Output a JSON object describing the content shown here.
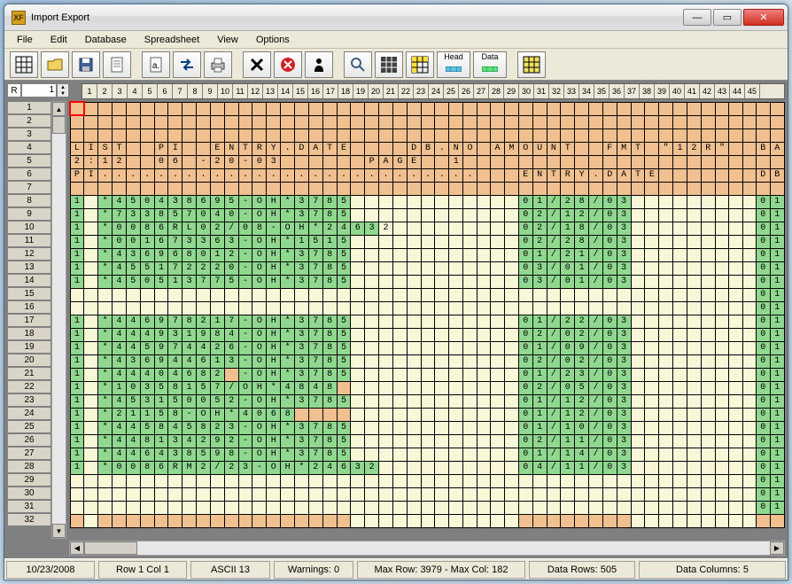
{
  "window": {
    "title": "Import Export"
  },
  "menu": [
    "File",
    "Edit",
    "Database",
    "Spreadsheet",
    "View",
    "Options"
  ],
  "toolbar": {
    "head_label": "Head",
    "data_label": "Data"
  },
  "ruler": {
    "r_label": "R",
    "r_value": "1"
  },
  "column_headers_start": 1,
  "column_headers_end": 45,
  "row_headers_start": 1,
  "row_headers_end": 32,
  "cursor": {
    "row": 1,
    "col": 1
  },
  "grid_rows": [
    {
      "r": 1,
      "cells": {}
    },
    {
      "r": 2,
      "cells": {}
    },
    {
      "r": 3,
      "cells": {}
    },
    {
      "r": 4,
      "cells": {
        "1": "L",
        "2": "I",
        "3": "S",
        "4": "T",
        "7": "P",
        "8": "I",
        "11": "E",
        "12": "N",
        "13": "T",
        "14": "R",
        "15": "Y",
        "16": ".",
        "17": "D",
        "18": "A",
        "19": "T",
        "20": "E",
        "25": "D",
        "26": "B",
        "27": ".",
        "28": "N",
        "29": "O",
        "31": "A",
        "32": "M",
        "33": "O",
        "34": "U",
        "35": "N",
        "36": "T",
        "39": "F",
        "40": "M",
        "41": "T",
        "43": "\"",
        "44": "1",
        "45": "2",
        "46": "R",
        "47": "\"",
        "50": "B",
        "51": "A"
      }
    },
    {
      "r": 5,
      "cells": {
        "1": "2",
        "2": ":",
        "3": "1",
        "4": "2",
        "7": "0",
        "8": "6",
        "10": "-",
        "11": "2",
        "12": "0",
        "13": "-",
        "14": "0",
        "15": "3",
        "22": "P",
        "23": "A",
        "24": "G",
        "25": "E",
        "28": "1"
      }
    },
    {
      "r": 6,
      "cells": {
        "1": "P",
        "2": "I",
        "3": ".",
        "4": ".",
        "5": ".",
        "6": ".",
        "7": ".",
        "8": ".",
        "9": ".",
        "10": ".",
        "11": ".",
        "12": ".",
        "13": ".",
        "14": ".",
        "15": ".",
        "16": ".",
        "17": ".",
        "18": ".",
        "19": ".",
        "20": ".",
        "21": ".",
        "22": ".",
        "23": ".",
        "24": ".",
        "25": ".",
        "26": ".",
        "27": ".",
        "28": ".",
        "29": ".",
        "33": "E",
        "34": "N",
        "35": "T",
        "36": "R",
        "37": "Y",
        "38": ".",
        "39": "D",
        "40": "A",
        "41": "T",
        "42": "E",
        "50": "D",
        "51": "B"
      }
    },
    {
      "r": 7,
      "cells": {}
    },
    {
      "r": 8,
      "cells": {
        "1": "1",
        "3": "*",
        "4": "4",
        "5": "5",
        "6": "0",
        "7": "4",
        "8": "3",
        "9": "8",
        "10": "6",
        "11": "9",
        "12": "5",
        "13": "-",
        "14": "O",
        "15": "H",
        "16": "*",
        "17": "3",
        "18": "7",
        "19": "8",
        "20": "5",
        "33": "0",
        "34": "1",
        "35": "/",
        "36": "2",
        "37": "8",
        "38": "/",
        "39": "0",
        "40": "3",
        "50": "0",
        "51": "1"
      }
    },
    {
      "r": 9,
      "cells": {
        "1": "1",
        "3": "*",
        "4": "7",
        "5": "3",
        "6": "3",
        "7": "8",
        "8": "5",
        "9": "7",
        "10": "0",
        "11": "4",
        "12": "0",
        "13": "-",
        "14": "O",
        "15": "H",
        "16": "*",
        "17": "3",
        "18": "7",
        "19": "8",
        "20": "5",
        "33": "0",
        "34": "2",
        "35": "/",
        "36": "1",
        "37": "2",
        "38": "/",
        "39": "0",
        "40": "3",
        "50": "0",
        "51": "1"
      }
    },
    {
      "r": 10,
      "cells": {
        "1": "1",
        "3": "*",
        "4": "0",
        "5": "0",
        "6": "8",
        "7": "6",
        "8": "R",
        "9": "L",
        "10": "0",
        "11": "2",
        "12": "/",
        "13": "0",
        "14": "8",
        "15": "-",
        "16": "O",
        "17": "H",
        "18": "*",
        "19": "2",
        "20": "4",
        "21": "6",
        "22": "3",
        "23": "2",
        "33": "0",
        "34": "2",
        "35": "/",
        "36": "1",
        "37": "8",
        "38": "/",
        "39": "0",
        "40": "3",
        "50": "0",
        "51": "1"
      }
    },
    {
      "r": 11,
      "cells": {
        "1": "1",
        "3": "*",
        "4": "0",
        "5": "0",
        "6": "1",
        "7": "6",
        "8": "7",
        "9": "3",
        "10": "3",
        "11": "6",
        "12": "3",
        "13": "-",
        "14": "O",
        "15": "H",
        "16": "*",
        "17": "1",
        "18": "5",
        "19": "1",
        "20": "5",
        "33": "0",
        "34": "2",
        "35": "/",
        "36": "2",
        "37": "8",
        "38": "/",
        "39": "0",
        "40": "3",
        "50": "0",
        "51": "1"
      }
    },
    {
      "r": 12,
      "cells": {
        "1": "1",
        "3": "*",
        "4": "4",
        "5": "3",
        "6": "6",
        "7": "9",
        "8": "6",
        "9": "8",
        "10": "0",
        "11": "1",
        "12": "2",
        "13": "-",
        "14": "O",
        "15": "H",
        "16": "*",
        "17": "3",
        "18": "7",
        "19": "8",
        "20": "5",
        "33": "0",
        "34": "1",
        "35": "/",
        "36": "2",
        "37": "1",
        "38": "/",
        "39": "0",
        "40": "3",
        "50": "0",
        "51": "1"
      }
    },
    {
      "r": 13,
      "cells": {
        "1": "1",
        "3": "*",
        "4": "4",
        "5": "5",
        "6": "5",
        "7": "1",
        "8": "7",
        "9": "2",
        "10": "2",
        "11": "2",
        "12": "0",
        "13": "-",
        "14": "O",
        "15": "H",
        "16": "*",
        "17": "3",
        "18": "7",
        "19": "8",
        "20": "5",
        "33": "0",
        "34": "3",
        "35": "/",
        "36": "0",
        "37": "1",
        "38": "/",
        "39": "0",
        "40": "3",
        "50": "0",
        "51": "1"
      }
    },
    {
      "r": 14,
      "cells": {
        "1": "1",
        "3": "*",
        "4": "4",
        "5": "5",
        "6": "0",
        "7": "5",
        "8": "1",
        "9": "3",
        "10": "7",
        "11": "7",
        "12": "5",
        "13": "-",
        "14": "O",
        "15": "H",
        "16": "*",
        "17": "3",
        "18": "7",
        "19": "8",
        "20": "5",
        "33": "0",
        "34": "3",
        "35": "/",
        "36": "0",
        "37": "1",
        "38": "/",
        "39": "0",
        "40": "3",
        "50": "0",
        "51": "1"
      }
    },
    {
      "r": 15,
      "cells": {
        "50": "0",
        "51": "1"
      }
    },
    {
      "r": 16,
      "cells": {
        "50": "0",
        "51": "1"
      }
    },
    {
      "r": 17,
      "cells": {
        "1": "1",
        "3": "*",
        "4": "4",
        "5": "4",
        "6": "6",
        "7": "9",
        "8": "7",
        "9": "8",
        "10": "2",
        "11": "1",
        "12": "7",
        "13": "-",
        "14": "O",
        "15": "H",
        "16": "*",
        "17": "3",
        "18": "7",
        "19": "8",
        "20": "5",
        "33": "0",
        "34": "1",
        "35": "/",
        "36": "2",
        "37": "2",
        "38": "/",
        "39": "0",
        "40": "3",
        "50": "0",
        "51": "1"
      }
    },
    {
      "r": 18,
      "cells": {
        "1": "1",
        "3": "*",
        "4": "4",
        "5": "4",
        "6": "4",
        "7": "9",
        "8": "3",
        "9": "1",
        "10": "9",
        "11": "8",
        "12": "4",
        "13": "-",
        "14": "O",
        "15": "H",
        "16": "*",
        "17": "3",
        "18": "7",
        "19": "8",
        "20": "5",
        "33": "0",
        "34": "2",
        "35": "/",
        "36": "0",
        "37": "2",
        "38": "/",
        "39": "0",
        "40": "3",
        "50": "0",
        "51": "1"
      }
    },
    {
      "r": 19,
      "cells": {
        "1": "1",
        "3": "*",
        "4": "4",
        "5": "4",
        "6": "5",
        "7": "9",
        "8": "7",
        "9": "4",
        "10": "4",
        "11": "2",
        "12": "6",
        "13": "-",
        "14": "O",
        "15": "H",
        "16": "*",
        "17": "3",
        "18": "7",
        "19": "8",
        "20": "5",
        "33": "0",
        "34": "1",
        "35": "/",
        "36": "0",
        "37": "9",
        "38": "/",
        "39": "0",
        "40": "3",
        "50": "0",
        "51": "1"
      }
    },
    {
      "r": 20,
      "cells": {
        "1": "1",
        "3": "*",
        "4": "4",
        "5": "3",
        "6": "6",
        "7": "9",
        "8": "4",
        "9": "4",
        "10": "6",
        "11": "1",
        "12": "3",
        "13": "-",
        "14": "O",
        "15": "H",
        "16": "*",
        "17": "3",
        "18": "7",
        "19": "8",
        "20": "5",
        "33": "0",
        "34": "2",
        "35": "/",
        "36": "0",
        "37": "2",
        "38": "/",
        "39": "0",
        "40": "3",
        "50": "0",
        "51": "1"
      }
    },
    {
      "r": 21,
      "cells": {
        "1": "1",
        "3": "*",
        "4": "4",
        "5": "4",
        "6": "4",
        "7": "0",
        "8": "4",
        "9": "6",
        "10": "8",
        "11": "2",
        "13": "-",
        "14": "O",
        "15": "H",
        "16": "*",
        "17": "3",
        "18": "7",
        "19": "8",
        "20": "5",
        "33": "0",
        "34": "1",
        "35": "/",
        "36": "2",
        "37": "3",
        "38": "/",
        "39": "0",
        "40": "3",
        "50": "0",
        "51": "1"
      }
    },
    {
      "r": 22,
      "cells": {
        "1": "1",
        "3": "*",
        "4": "1",
        "5": "0",
        "6": "3",
        "7": "5",
        "8": "8",
        "9": "1",
        "10": "5",
        "11": "7",
        "12": "/",
        "13": "O",
        "14": "H",
        "15": "*",
        "16": "4",
        "17": "8",
        "18": "4",
        "19": "8",
        "33": "0",
        "34": "2",
        "35": "/",
        "36": "0",
        "37": "5",
        "38": "/",
        "39": "0",
        "40": "3",
        "50": "0",
        "51": "1"
      }
    },
    {
      "r": 23,
      "cells": {
        "1": "1",
        "3": "*",
        "4": "4",
        "5": "5",
        "6": "3",
        "7": "1",
        "8": "5",
        "9": "0",
        "10": "0",
        "11": "5",
        "12": "2",
        "13": "-",
        "14": "O",
        "15": "H",
        "16": "*",
        "17": "3",
        "18": "7",
        "19": "8",
        "20": "5",
        "33": "0",
        "34": "1",
        "35": "/",
        "36": "1",
        "37": "2",
        "38": "/",
        "39": "0",
        "40": "3",
        "50": "0",
        "51": "1"
      }
    },
    {
      "r": 24,
      "cells": {
        "1": "1",
        "3": "*",
        "4": "2",
        "5": "1",
        "6": "1",
        "7": "5",
        "8": "8",
        "9": "-",
        "10": "O",
        "11": "H",
        "12": "*",
        "13": "4",
        "14": "0",
        "15": "6",
        "16": "8",
        "33": "0",
        "34": "1",
        "35": "/",
        "36": "1",
        "37": "2",
        "38": "/",
        "39": "0",
        "40": "3",
        "50": "0",
        "51": "1"
      }
    },
    {
      "r": 25,
      "cells": {
        "1": "1",
        "3": "*",
        "4": "4",
        "5": "4",
        "6": "5",
        "7": "8",
        "8": "4",
        "9": "5",
        "10": "8",
        "11": "2",
        "12": "3",
        "13": "-",
        "14": "O",
        "15": "H",
        "16": "*",
        "17": "3",
        "18": "7",
        "19": "8",
        "20": "5",
        "33": "0",
        "34": "1",
        "35": "/",
        "36": "1",
        "37": "0",
        "38": "/",
        "39": "0",
        "40": "3",
        "50": "0",
        "51": "1"
      }
    },
    {
      "r": 26,
      "cells": {
        "1": "1",
        "3": "*",
        "4": "4",
        "5": "4",
        "6": "8",
        "7": "1",
        "8": "3",
        "9": "4",
        "10": "2",
        "11": "9",
        "12": "2",
        "13": "-",
        "14": "O",
        "15": "H",
        "16": "*",
        "17": "3",
        "18": "7",
        "19": "8",
        "20": "5",
        "33": "0",
        "34": "2",
        "35": "/",
        "36": "1",
        "37": "1",
        "38": "/",
        "39": "0",
        "40": "3",
        "50": "0",
        "51": "1"
      }
    },
    {
      "r": 27,
      "cells": {
        "1": "1",
        "3": "*",
        "4": "4",
        "5": "4",
        "6": "6",
        "7": "4",
        "8": "3",
        "9": "8",
        "10": "5",
        "11": "9",
        "12": "8",
        "13": "-",
        "14": "O",
        "15": "H",
        "16": "*",
        "17": "3",
        "18": "7",
        "19": "8",
        "20": "5",
        "33": "0",
        "34": "1",
        "35": "/",
        "36": "1",
        "37": "4",
        "38": "/",
        "39": "0",
        "40": "3",
        "50": "0",
        "51": "1"
      }
    },
    {
      "r": 28,
      "cells": {
        "1": "1",
        "3": "*",
        "4": "0",
        "5": "0",
        "6": "8",
        "7": "6",
        "8": "R",
        "9": "M",
        "10": "2",
        "11": "/",
        "12": "2",
        "13": "3",
        "14": "-",
        "15": "O",
        "16": "H",
        "17": "*",
        "18": "2",
        "19": "4",
        "20": "6",
        "21": "3",
        "22": "2",
        "33": "0",
        "34": "4",
        "35": "/",
        "36": "1",
        "37": "1",
        "38": "/",
        "39": "0",
        "40": "3",
        "50": "0",
        "51": "1"
      }
    },
    {
      "r": 29,
      "cells": {
        "50": "0",
        "51": "1"
      }
    },
    {
      "r": 30,
      "cells": {
        "50": "0",
        "51": "1"
      }
    },
    {
      "r": 31,
      "cells": {
        "50": "0",
        "51": "1"
      }
    },
    {
      "r": 32,
      "cells": {}
    }
  ],
  "status": {
    "date": "10/23/2008",
    "pos": "Row 1 Col 1",
    "ascii": "ASCII 13",
    "warnings": "Warnings: 0",
    "max": "Max Row: 3979 - Max Col: 182",
    "data_rows": "Data Rows: 505",
    "data_cols": "Data Columns: 5"
  }
}
